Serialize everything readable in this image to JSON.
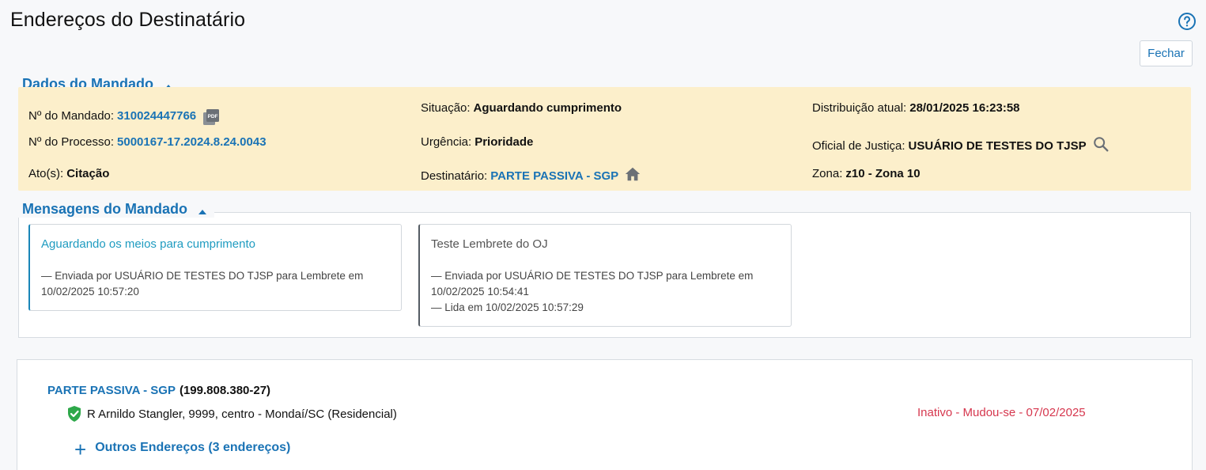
{
  "header": {
    "title": "Endereços do Destinatário",
    "close_label": "Fechar",
    "help_icon": "help-circle-icon"
  },
  "colors": {
    "link": "#1a73b5",
    "panel_bg": "#fcefcb",
    "status_inactive": "#d6374e",
    "valid_icon": "#2ea84a"
  },
  "dados": {
    "section_title": "Dados do Mandado",
    "numero_mandado": {
      "label": "Nº do Mandado:",
      "value": "310024447766",
      "icon": "pdf-icon"
    },
    "situacao": {
      "label": "Situação:",
      "value": "Aguardando cumprimento"
    },
    "distribuicao": {
      "label": "Distribuição atual:",
      "value": "28/01/2025 16:23:58"
    },
    "numero_processo": {
      "label": "Nº do Processo:",
      "value": "5000167-17.2024.8.24.0043"
    },
    "urgencia": {
      "label": "Urgência:",
      "value": "Prioridade"
    },
    "oficial": {
      "label": "Oficial de Justiça:",
      "value": "USUÁRIO DE TESTES DO TJSP",
      "icon": "search-icon"
    },
    "atos": {
      "label": "Ato(s):",
      "value": "Citação"
    },
    "destinatario": {
      "label": "Destinatário:",
      "value": "PARTE PASSIVA - SGP",
      "icon": "home-icon"
    },
    "zona": {
      "label": "Zona:",
      "value": "z10 - Zona 10"
    }
  },
  "mensagens": {
    "section_title": "Mensagens do Mandado",
    "items": [
      {
        "title": "Aguardando os meios para cumprimento",
        "lines": [
          "—  Enviada por USUÁRIO DE TESTES DO TJSP para Lembrete em",
          "10/02/2025 10:57:20"
        ]
      },
      {
        "title": "Teste Lembrete do OJ",
        "lines": [
          "—  Enviada por USUÁRIO DE TESTES DO TJSP para Lembrete em",
          "10/02/2025 10:54:41",
          "—  Lida em 10/02/2025 10:57:29"
        ]
      }
    ]
  },
  "destinatario_box": {
    "name": "PARTE PASSIVA - SGP",
    "document": "(199.808.380-27)",
    "address": "R Arnildo Stangler, 9999, centro - Mondaí/SC (Residencial)",
    "address_icon": "check-shield-icon",
    "status": "Inativo - Mudou-se - 07/02/2025",
    "outros_label": "Outros Endereços (3 endereços)",
    "outros_icon": "plus-icon"
  }
}
